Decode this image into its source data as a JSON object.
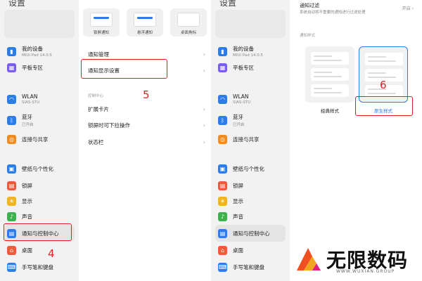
{
  "settings_title": "设置",
  "settings_list": [
    {
      "label": "我的设备",
      "sub": "MIUI Pad 14.0.5",
      "icon": "device-icon",
      "color": "#2b7de9"
    },
    {
      "label": "平板专区",
      "sub": "",
      "icon": "tablet-zone-icon",
      "color": "#7a5cf0"
    },
    {
      "label": "WLAN",
      "sub": "SIAS-STU",
      "icon": "wifi-icon",
      "color": "#2b7de9"
    },
    {
      "label": "蓝牙",
      "sub": "已开启",
      "icon": "bluetooth-icon",
      "color": "#2b7de9"
    },
    {
      "label": "连接与共享",
      "sub": "",
      "icon": "connection-share-icon",
      "color": "#f08c1f"
    },
    {
      "label": "壁纸与个性化",
      "sub": "",
      "icon": "wallpaper-icon",
      "color": "#2b7de9"
    },
    {
      "label": "锁屏",
      "sub": "",
      "icon": "lock-screen-icon",
      "color": "#f05a3a"
    },
    {
      "label": "显示",
      "sub": "",
      "icon": "display-icon",
      "color": "#f0b41f"
    },
    {
      "label": "声音",
      "sub": "",
      "icon": "sound-icon",
      "color": "#3ab34a"
    },
    {
      "label": "通知与控制中心",
      "sub": "",
      "icon": "notification-center-icon",
      "color": "#2b7de9"
    },
    {
      "label": "桌面",
      "sub": "",
      "icon": "desktop-icon",
      "color": "#f05a3a"
    },
    {
      "label": "手写笔和键盘",
      "sub": "",
      "icon": "stylus-keyboard-icon",
      "color": "#2b7de9"
    }
  ],
  "notif": {
    "thumbs": [
      "锁屏通知",
      "悬浮通知",
      "桌面角标"
    ],
    "rows": [
      "通知管理",
      "通知显示设置"
    ],
    "section_control": "控制中心",
    "control_rows": [
      "扩展卡片",
      "锁屏时可下拉操作",
      "状态栏"
    ],
    "chevron": "›"
  },
  "display_settings": {
    "filter_title": "通知过滤",
    "filter_sub": "系统自动将不重要的通知进行过滤处理",
    "filter_value": "开启 ›",
    "style_header": "通知样式",
    "styles": [
      "经典样式",
      "原生样式"
    ]
  },
  "steps": [
    "4",
    "5",
    "6"
  ],
  "watermark": {
    "title": "无限数码",
    "sub": "WWW.WUXIAN.GROUP"
  },
  "colors": {
    "highlight": "#e02020",
    "accent": "#2b7de9"
  }
}
